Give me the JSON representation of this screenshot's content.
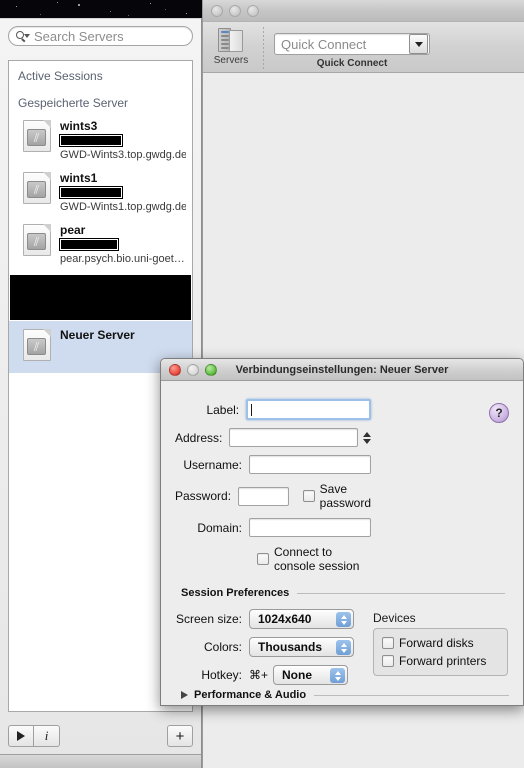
{
  "desktop": {
    "name": "starfield-desktop"
  },
  "back_window": {
    "title": "",
    "traffic_lights": [
      "close",
      "minimize",
      "zoom"
    ],
    "toolbar": {
      "servers": {
        "label": "Servers",
        "icon": "server-rack-icon"
      },
      "quick_connect": {
        "group_label": "Quick Connect",
        "placeholder": "Quick Connect",
        "value": "",
        "dropdown_icon": "caret-down-icon"
      }
    }
  },
  "list_window": {
    "search": {
      "placeholder": "Search Servers",
      "value": "",
      "icon": "search-icon"
    },
    "groups": [
      {
        "label": "Active Sessions",
        "items": []
      },
      {
        "label": "Gespeicherte Server",
        "items": [
          {
            "name": "wints3",
            "redacted": true,
            "host": "GWD-Wints3.top.gwdg.de",
            "icon": "rdp-document-icon",
            "selected": false
          },
          {
            "name": "wints1",
            "redacted": true,
            "host": "GWD-Wints1.top.gwdg.de",
            "icon": "rdp-document-icon",
            "selected": false
          },
          {
            "name": "pear",
            "redacted": true,
            "host": "pear.psych.bio.uni-goet…",
            "icon": "rdp-document-icon",
            "selected": false
          },
          {
            "name": "",
            "redacted_block": true,
            "host": "",
            "icon": "",
            "selected": false
          },
          {
            "name": "Neuer Server",
            "redacted": false,
            "host": "",
            "icon": "rdp-document-icon",
            "selected": true
          }
        ]
      }
    ],
    "bottom_toolbar": {
      "connect_label": "▶",
      "info_label": "і",
      "add_label": "+"
    }
  },
  "dialog": {
    "title": "Verbindungseinstellungen: Neuer Server",
    "help_label": "?",
    "fields": [
      {
        "label": "Label:",
        "value": "",
        "focused": true
      },
      {
        "label": "Address:",
        "value": "",
        "focused": false,
        "stepper": true
      },
      {
        "label": "Username:",
        "value": "",
        "focused": false
      },
      {
        "label": "Password:",
        "value": "",
        "focused": false
      },
      {
        "label": "Domain:",
        "value": "",
        "focused": false
      }
    ],
    "save_password": {
      "label": "Save password",
      "checked": false
    },
    "connect_console": {
      "label": "Connect to console session",
      "checked": false
    },
    "session_preferences": {
      "header": "Session Preferences",
      "screen_size": {
        "label": "Screen size:",
        "value": "1024x640"
      },
      "colors": {
        "label": "Colors:",
        "value": "Thousands"
      },
      "hotkey": {
        "label": "Hotkey:",
        "modifier": "⌘+",
        "value": "None"
      }
    },
    "devices": {
      "label": "Devices",
      "items": [
        {
          "label": "Forward disks",
          "checked": false
        },
        {
          "label": "Forward printers",
          "checked": false
        }
      ]
    },
    "performance_audio": {
      "label": "Performance & Audio",
      "expanded": false
    }
  },
  "colors": {
    "selection_blue": "#cfdcef",
    "stepper_blue": "#6f9fd6",
    "help_purple": "#a487c6",
    "close_red": "#e8463a",
    "zoom_green": "#5bbb3c"
  }
}
